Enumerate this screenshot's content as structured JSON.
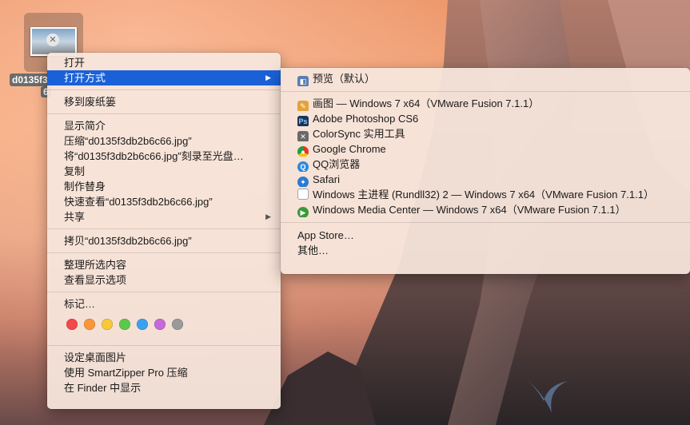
{
  "desktop": {
    "file_label_line1": "d0135f3",
    "file_label_line2": "6"
  },
  "main_menu": {
    "items": [
      {
        "label": "打开"
      },
      {
        "label": "打开方式"
      },
      {
        "label": "移到废纸篓"
      },
      {
        "label": "显示简介"
      },
      {
        "label": "压缩“d0135f3db2b6c66.jpg”"
      },
      {
        "label": "将“d0135f3db2b6c66.jpg”刻录至光盘…"
      },
      {
        "label": "复制"
      },
      {
        "label": "制作替身"
      },
      {
        "label": "快速查看“d0135f3db2b6c66.jpg”"
      },
      {
        "label": "共享"
      },
      {
        "label": "拷贝“d0135f3db2b6c66.jpg”"
      },
      {
        "label": "整理所选内容"
      },
      {
        "label": "查看显示选项"
      },
      {
        "label": "标记…"
      },
      {
        "label": "设定桌面图片"
      },
      {
        "label": "使用 SmartZipper Pro 压缩"
      },
      {
        "label": "在 Finder 中显示"
      }
    ],
    "tag_colors": [
      "#f2484a",
      "#f8963a",
      "#f6c83a",
      "#5cc94a",
      "#3aa0f0",
      "#c56ad8",
      "#9a9a9a"
    ]
  },
  "sub_menu": {
    "items": [
      {
        "label": "预览（默认）",
        "icon": "preview-icon",
        "color": "#5a7fb0"
      },
      {
        "label": "画图 — Windows 7 x64（VMware Fusion 7.1.1）",
        "icon": "paint-icon",
        "color": "#e3a33a"
      },
      {
        "label": "Adobe Photoshop CS6",
        "icon": "photoshop-icon",
        "color": "#16355c"
      },
      {
        "label": "ColorSync 实用工具",
        "icon": "colorsync-icon",
        "color": "#6a6a6a"
      },
      {
        "label": "Google Chrome",
        "icon": "chrome-icon",
        "color": "#e0392b"
      },
      {
        "label": "QQ浏览器",
        "icon": "qq-browser-icon",
        "color": "#2d8ae0"
      },
      {
        "label": "Safari",
        "icon": "safari-icon",
        "color": "#2e7ad1"
      },
      {
        "label": "Windows 主进程 (Rundll32) 2 — Windows 7 x64（VMware Fusion 7.1.1）",
        "icon": "document-icon",
        "color": "#9aa6b5"
      },
      {
        "label": "Windows Media Center — Windows 7 x64（VMware Fusion 7.1.1）",
        "icon": "media-center-icon",
        "color": "#3a9a3a"
      },
      {
        "label": "App Store…"
      },
      {
        "label": "其他…"
      }
    ]
  }
}
